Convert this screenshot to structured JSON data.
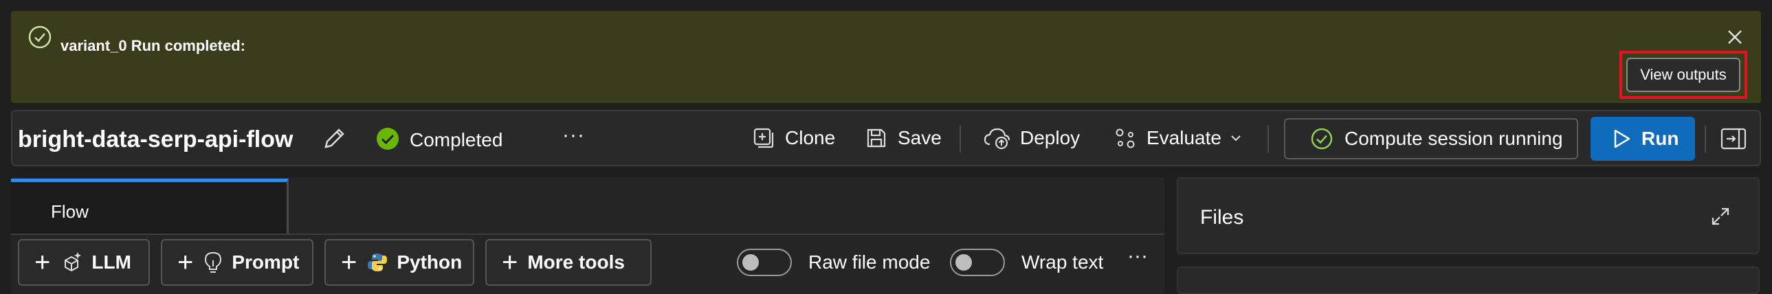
{
  "banner": {
    "message": "variant_0 Run completed:",
    "view_outputs_label": "View outputs",
    "accent_color": "#393d1b",
    "highlight_color": "#e81123"
  },
  "toolbar": {
    "flow_name": "bright-data-serp-api-flow",
    "status": "Completed",
    "more_label": "···",
    "clone_label": "Clone",
    "save_label": "Save",
    "deploy_label": "Deploy",
    "evaluate_label": "Evaluate",
    "compute_label": "Compute session running",
    "run_label": "Run",
    "run_color": "#0f6cbd",
    "status_color": "#6bb700"
  },
  "editor": {
    "tabs": [
      {
        "label": "Flow",
        "active": true
      }
    ],
    "tools": [
      {
        "label": "LLM",
        "icon": "llm-icon"
      },
      {
        "label": "Prompt",
        "icon": "lightbulb-icon"
      },
      {
        "label": "Python",
        "icon": "python-icon"
      },
      {
        "label": "More tools",
        "icon": ""
      }
    ],
    "raw_file_mode_label": "Raw file mode",
    "raw_file_mode_on": false,
    "wrap_text_label": "Wrap text",
    "wrap_text_on": false,
    "more_label": "···"
  },
  "files": {
    "title": "Files"
  }
}
